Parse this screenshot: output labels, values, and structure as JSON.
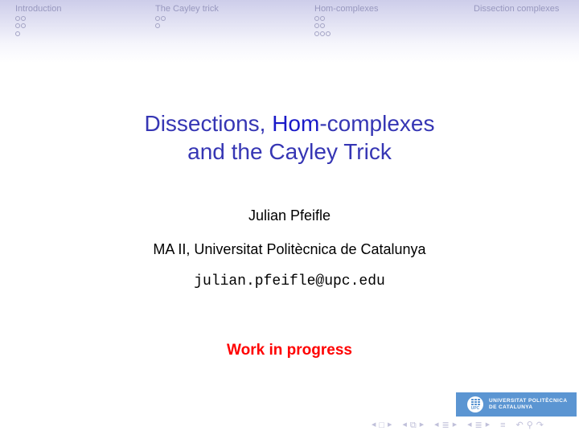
{
  "headline": {
    "sections": [
      {
        "label": "Introduction",
        "rows": [
          2,
          2,
          1
        ]
      },
      {
        "label": "The Cayley trick",
        "rows": [
          2,
          1
        ]
      },
      {
        "label": "Hom-complexes",
        "rows": [
          2,
          2,
          3
        ]
      },
      {
        "label": "Dissection complexes",
        "rows": []
      }
    ]
  },
  "title": {
    "line1_part1": "Dissections, ",
    "line1_highlight": "Hom",
    "line1_part2": "-complexes",
    "line2": "and the Cayley Trick"
  },
  "author": "Julian Pfeifle",
  "institute": "MA II, Universitat Politècnica de Catalunya",
  "email": "julian.pfeifle@upc.edu",
  "note": "Work in progress",
  "logo": {
    "mark_text": "UPC",
    "line1": "UNIVERSITAT POLITÈCNICA",
    "line2": "DE CATALUNYA"
  },
  "colors": {
    "title": "#3636b4",
    "title_highlight": "#1919c8",
    "note": "#ff0000",
    "logo_bg": "#5b95d2"
  },
  "nav_symbols": {
    "frame": [
      "prev-arrow",
      "frame-icon",
      "next-arrow"
    ],
    "subsection": [
      "prev-arrow",
      "subsection-icon",
      "next-arrow"
    ],
    "section": [
      "prev-arrow",
      "section-icon",
      "next-arrow"
    ],
    "subsubsection": [
      "prev-arrow",
      "subsubsection-icon",
      "next-arrow"
    ],
    "document": [
      "document-icon"
    ],
    "tools": [
      "back-icon",
      "search-icon",
      "forward-icon"
    ]
  }
}
